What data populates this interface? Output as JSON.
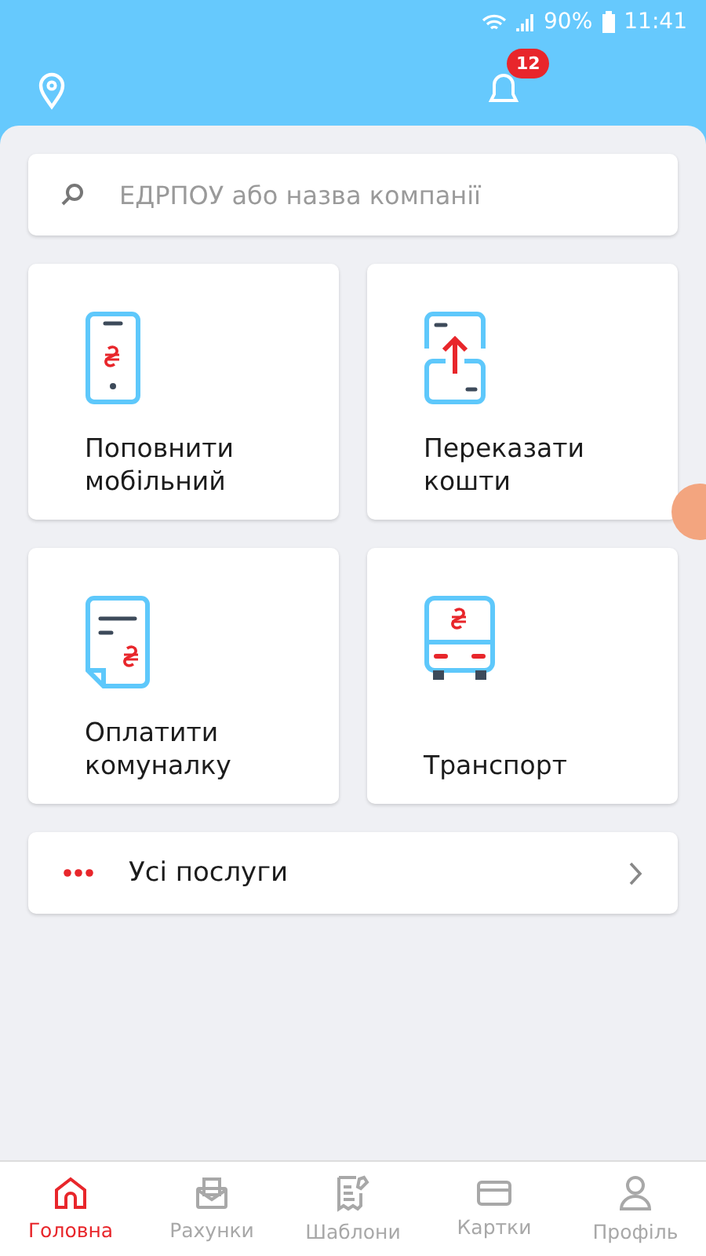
{
  "status_bar": {
    "battery": "90%",
    "time": "11:41"
  },
  "header": {
    "notifications_badge": "12"
  },
  "search": {
    "placeholder": "ЕДРПОУ або назва компанії"
  },
  "tiles": [
    {
      "kind": "mobile",
      "label": "Поповнити мобільний"
    },
    {
      "kind": "transfer",
      "label": "Переказати кошти"
    },
    {
      "kind": "bill",
      "label": "Оплатити комуналку"
    },
    {
      "kind": "bus",
      "label": "Транспорт"
    }
  ],
  "all_services": {
    "label": "Усі послуги"
  },
  "nav": [
    {
      "kind": "home",
      "label": "Головна",
      "selected": true
    },
    {
      "kind": "accounts",
      "label": "Рахунки",
      "selected": false
    },
    {
      "kind": "templates",
      "label": "Шаблони",
      "selected": false
    },
    {
      "kind": "cards",
      "label": "Картки",
      "selected": false
    },
    {
      "kind": "profile",
      "label": "Профіль",
      "selected": false
    }
  ]
}
